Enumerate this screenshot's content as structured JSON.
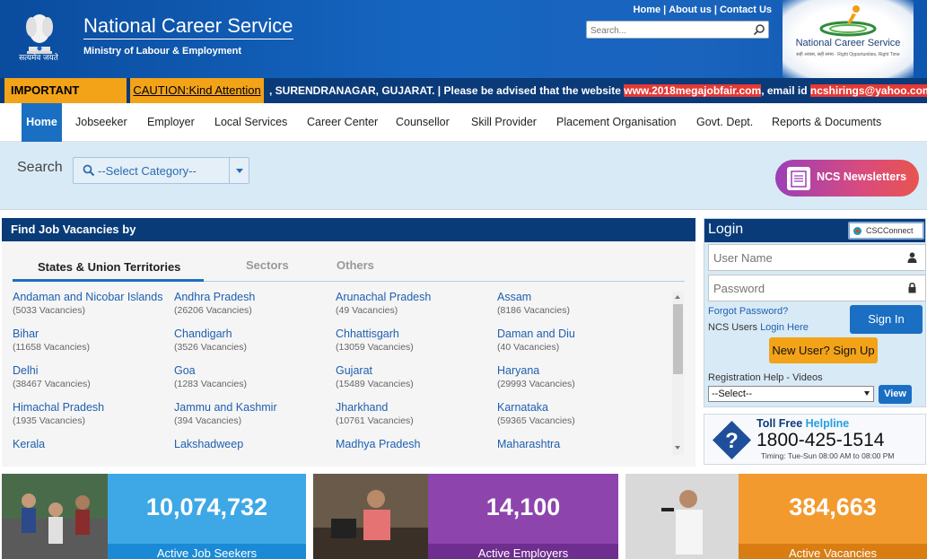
{
  "header": {
    "emblem_motto": "सत्यमेव जयते",
    "site_title": "National Career Service",
    "site_subtitle": "Ministry of Labour & Employment",
    "top_links": [
      "Home",
      "About us",
      "Contact Us"
    ],
    "search_placeholder": "Search...",
    "logo_name": "National Career Service",
    "logo_tagline": "सही अवसर, सही समय · Right Opportunities, Right Time"
  },
  "notice": {
    "label": "IMPORTANT NOTICE",
    "caution_link": "CAUTION:Kind Attention",
    "text_prefix": ", SURENDRANAGAR, GUJARAT.   |   Please be advised that the website ",
    "highlight_site": "www.2018megajobfair.com",
    "text_mid": ", email id ",
    "highlight_email": "ncshirings@yahoo.com"
  },
  "nav": {
    "items": [
      "Home",
      "Jobseeker",
      "Employer",
      "Local Services",
      "Career Center",
      "Counsellor",
      "Skill Provider",
      "Placement Organisation",
      "Govt. Dept.",
      "Reports & Documents"
    ]
  },
  "search": {
    "label": "Search",
    "category_placeholder": "--Select Category--",
    "newsletter_label": "NCS Newsletters"
  },
  "find_jobs": {
    "title": "Find Job Vacancies by",
    "tabs": [
      "States & Union Territories",
      "Sectors",
      "Others"
    ],
    "states": [
      {
        "name": "Andaman and Nicobar Islands",
        "count": "(5033 Vacancies)"
      },
      {
        "name": "Andhra Pradesh",
        "count": "(26206 Vacancies)"
      },
      {
        "name": "Arunachal Pradesh",
        "count": "(49 Vacancies)"
      },
      {
        "name": "Assam",
        "count": "(8186 Vacancies)"
      },
      {
        "name": "Bihar",
        "count": "(11658 Vacancies)"
      },
      {
        "name": "Chandigarh",
        "count": "(3526 Vacancies)"
      },
      {
        "name": "Chhattisgarh",
        "count": "(13059 Vacancies)"
      },
      {
        "name": "Daman and Diu",
        "count": "(40 Vacancies)"
      },
      {
        "name": "Delhi",
        "count": "(38467 Vacancies)"
      },
      {
        "name": "Goa",
        "count": "(1283 Vacancies)"
      },
      {
        "name": "Gujarat",
        "count": "(15489 Vacancies)"
      },
      {
        "name": "Haryana",
        "count": "(29993 Vacancies)"
      },
      {
        "name": "Himachal Pradesh",
        "count": "(1935 Vacancies)"
      },
      {
        "name": "Jammu and Kashmir",
        "count": "(394 Vacancies)"
      },
      {
        "name": "Jharkhand",
        "count": "(10761 Vacancies)"
      },
      {
        "name": "Karnataka",
        "count": "(59365 Vacancies)"
      },
      {
        "name": "Kerala",
        "count": ""
      },
      {
        "name": "Lakshadweep",
        "count": ""
      },
      {
        "name": "Madhya Pradesh",
        "count": ""
      },
      {
        "name": "Maharashtra",
        "count": ""
      }
    ]
  },
  "login": {
    "title": "Login",
    "csc_label": "CSCConnect",
    "username_placeholder": "User Name",
    "password_placeholder": "Password",
    "forgot_password": "Forgot Password?",
    "ncs_users_prefix": "NCS Users ",
    "login_here": "Login Here",
    "signin_label": "Sign In",
    "signup_label": "New User? Sign Up",
    "reg_help_label": "Registration Help - Videos",
    "reg_select_value": "--Select--",
    "view_label": "View"
  },
  "helpline": {
    "toll_free": "Toll Free ",
    "helpline_word": "Helpline",
    "number": "1800-425-1514",
    "timing": "Timing: Tue-Sun 08:00 AM to 08:00 PM"
  },
  "stats": [
    {
      "number": "10,074,732",
      "label": "Active Job Seekers",
      "color": "#3ea8e6",
      "label_bg": "#1a8ad6"
    },
    {
      "number": "14,100",
      "label": "Active Employers",
      "color": "#8e44ad",
      "label_bg": "#6e2d8f"
    },
    {
      "number": "384,663",
      "label": "Active Vacancies",
      "color": "#f29a2e",
      "label_bg": "#d97d12"
    }
  ],
  "colors": {
    "header_blue": "#1565c0",
    "nav_active": "#1a6fc2",
    "notice_orange": "#f3a318",
    "panel_navy": "#083b78",
    "link_blue": "#1f5fb0"
  }
}
